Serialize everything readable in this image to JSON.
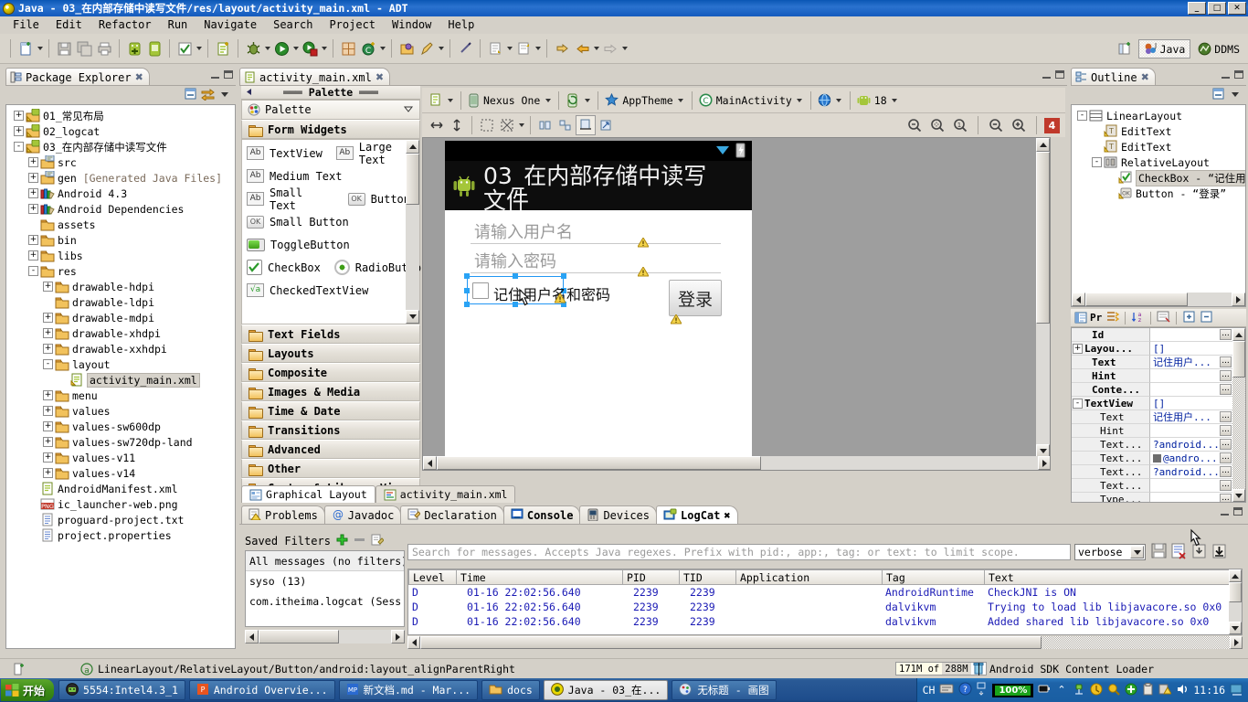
{
  "window": {
    "title": "Java - 03_在内部存储中读写文件/res/layout/activity_main.xml - ADT",
    "minimize": "_",
    "maximize": "□",
    "close": "✕"
  },
  "menu": {
    "items": [
      "File",
      "Edit",
      "Refactor",
      "Run",
      "Navigate",
      "Search",
      "Project",
      "Window",
      "Help"
    ]
  },
  "perspectives": {
    "java": "Java",
    "ddms": "DDMS"
  },
  "package_explorer": {
    "tab_label": "Package Explorer",
    "tree": [
      {
        "label": "01_常见布局",
        "depth": 0,
        "exp": "+",
        "icon": "android-project-icon"
      },
      {
        "label": "02_logcat",
        "depth": 0,
        "exp": "+",
        "icon": "android-project-icon"
      },
      {
        "label": "03_在内部存储中读写文件",
        "depth": 0,
        "exp": "-",
        "icon": "android-project-icon"
      },
      {
        "label": "src",
        "depth": 1,
        "exp": "+",
        "icon": "source-folder-icon"
      },
      {
        "label": "gen [Generated Java Files]",
        "depth": 1,
        "exp": "+",
        "icon": "source-folder-icon",
        "dim_from": 4
      },
      {
        "label": "Android 4.3",
        "depth": 1,
        "exp": "+",
        "icon": "library-icon"
      },
      {
        "label": "Android Dependencies",
        "depth": 1,
        "exp": "+",
        "icon": "library-icon"
      },
      {
        "label": "assets",
        "depth": 1,
        "exp": "",
        "icon": "folder-icon"
      },
      {
        "label": "bin",
        "depth": 1,
        "exp": "+",
        "icon": "folder-icon"
      },
      {
        "label": "libs",
        "depth": 1,
        "exp": "+",
        "icon": "folder-icon"
      },
      {
        "label": "res",
        "depth": 1,
        "exp": "-",
        "icon": "folder-icon"
      },
      {
        "label": "drawable-hdpi",
        "depth": 2,
        "exp": "+",
        "icon": "folder-icon"
      },
      {
        "label": "drawable-ldpi",
        "depth": 2,
        "exp": "",
        "icon": "folder-icon"
      },
      {
        "label": "drawable-mdpi",
        "depth": 2,
        "exp": "+",
        "icon": "folder-icon"
      },
      {
        "label": "drawable-xhdpi",
        "depth": 2,
        "exp": "+",
        "icon": "folder-icon"
      },
      {
        "label": "drawable-xxhdpi",
        "depth": 2,
        "exp": "+",
        "icon": "folder-icon"
      },
      {
        "label": "layout",
        "depth": 2,
        "exp": "-",
        "icon": "folder-icon"
      },
      {
        "label": "activity_main.xml",
        "depth": 3,
        "exp": "",
        "icon": "xml-layout-icon",
        "selected": true
      },
      {
        "label": "menu",
        "depth": 2,
        "exp": "+",
        "icon": "folder-icon"
      },
      {
        "label": "values",
        "depth": 2,
        "exp": "+",
        "icon": "folder-icon"
      },
      {
        "label": "values-sw600dp",
        "depth": 2,
        "exp": "+",
        "icon": "folder-icon"
      },
      {
        "label": "values-sw720dp-land",
        "depth": 2,
        "exp": "+",
        "icon": "folder-icon"
      },
      {
        "label": "values-v11",
        "depth": 2,
        "exp": "+",
        "icon": "folder-icon"
      },
      {
        "label": "values-v14",
        "depth": 2,
        "exp": "+",
        "icon": "folder-icon"
      },
      {
        "label": "AndroidManifest.xml",
        "depth": 1,
        "exp": "",
        "icon": "xml-file-icon"
      },
      {
        "label": "ic_launcher-web.png",
        "depth": 1,
        "exp": "",
        "icon": "png-file-icon"
      },
      {
        "label": "proguard-project.txt",
        "depth": 1,
        "exp": "",
        "icon": "text-file-icon"
      },
      {
        "label": "project.properties",
        "depth": 1,
        "exp": "",
        "icon": "text-file-icon"
      }
    ]
  },
  "editor": {
    "tab_label": "activity_main.xml",
    "palette": {
      "header": "Palette",
      "selector": "Palette",
      "group_open": "Form Widgets",
      "widgets": [
        [
          {
            "label": "TextView",
            "icon": "ab-icon"
          },
          {
            "label": "Large Text",
            "icon": "ab-icon"
          }
        ],
        [
          {
            "label": "Medium Text",
            "icon": "ab-icon"
          }
        ],
        [
          {
            "label": "Small Text",
            "icon": "ab-icon"
          },
          {
            "label": "Button",
            "icon": "ok-icon"
          }
        ],
        [
          {
            "label": "Small Button",
            "icon": "ok-icon"
          }
        ],
        [
          {
            "label": "ToggleButton",
            "icon": "toggle-icon"
          }
        ],
        [
          {
            "label": "CheckBox",
            "icon": "checkbox-icon"
          },
          {
            "label": "RadioButton",
            "icon": "radio-icon"
          }
        ],
        [
          {
            "label": "CheckedTextView",
            "icon": "checkedtext-icon"
          }
        ]
      ],
      "groups": [
        "Text Fields",
        "Layouts",
        "Composite",
        "Images & Media",
        "Time & Date",
        "Transitions",
        "Advanced",
        "Other",
        "Custom & Library Views"
      ]
    },
    "config": {
      "device": "Nexus One",
      "theme": "AppTheme",
      "activity": "MainActivity",
      "api": "18",
      "zoom_badge": "4"
    },
    "preview": {
      "app_title": "03_在内部存储中读写文件",
      "username_hint": "请输入用户名",
      "password_hint": "请输入密码",
      "checkbox_label": "记住用户名和密码",
      "login_button": "登录"
    },
    "bottom_tabs": [
      {
        "label": "Graphical Layout",
        "active": true
      },
      {
        "label": "activity_main.xml",
        "active": false
      }
    ]
  },
  "outline": {
    "tab_label": "Outline",
    "tree": [
      {
        "label": "LinearLayout",
        "depth": 0,
        "exp": "-",
        "icon": "linearlayout-icon"
      },
      {
        "label": "EditText",
        "depth": 1,
        "exp": "",
        "icon": "edittext-icon"
      },
      {
        "label": "EditText",
        "depth": 1,
        "exp": "",
        "icon": "edittext-icon"
      },
      {
        "label": "RelativeLayout",
        "depth": 1,
        "exp": "-",
        "icon": "relativelayout-icon"
      },
      {
        "label": "CheckBox - “记住用…",
        "depth": 2,
        "exp": "",
        "icon": "checkbox-icon",
        "selected": true
      },
      {
        "label": "Button - “登录”",
        "depth": 2,
        "exp": "",
        "icon": "button-icon"
      }
    ]
  },
  "properties": {
    "tab_label": "Pr",
    "rows": [
      {
        "name": "Id",
        "value": "",
        "indent": 1,
        "exp": "",
        "dots": true
      },
      {
        "name": "Layou...",
        "value": "[]",
        "indent": 0,
        "exp": "+",
        "dots": false
      },
      {
        "name": "Text",
        "value": "记住用户...",
        "indent": 1,
        "exp": "",
        "dots": true
      },
      {
        "name": "Hint",
        "value": "",
        "indent": 1,
        "exp": "",
        "dots": true
      },
      {
        "name": "Conte...",
        "value": "",
        "indent": 1,
        "exp": "",
        "dots": true
      },
      {
        "name": "TextView",
        "value": "[]",
        "indent": 0,
        "exp": "-",
        "dots": false
      },
      {
        "name": "Text",
        "value": "记住用户...",
        "indent": 2,
        "exp": "",
        "dots": true
      },
      {
        "name": "Hint",
        "value": "",
        "indent": 2,
        "exp": "",
        "dots": true
      },
      {
        "name": "Text...",
        "value": "?android...",
        "indent": 2,
        "exp": "",
        "dots": true
      },
      {
        "name": "Text...",
        "value": "@andro...",
        "indent": 2,
        "exp": "",
        "dots": true,
        "swatch": "#6e6e6e"
      },
      {
        "name": "Text...",
        "value": "?android...",
        "indent": 2,
        "exp": "",
        "dots": true
      },
      {
        "name": "Text...",
        "value": "",
        "indent": 2,
        "exp": "",
        "dots": true
      },
      {
        "name": "Type...",
        "value": "",
        "indent": 2,
        "exp": "",
        "dots": true
      }
    ]
  },
  "logcat": {
    "tabs": [
      {
        "label": "Problems",
        "icon": "problems-icon",
        "active": false
      },
      {
        "label": "Javadoc",
        "icon": "javadoc-icon",
        "active": false
      },
      {
        "label": "Declaration",
        "icon": "declaration-icon",
        "active": false
      },
      {
        "label": "Console",
        "icon": "console-icon",
        "active": false,
        "bold": true
      },
      {
        "label": "Devices",
        "icon": "devices-icon",
        "active": false
      },
      {
        "label": "LogCat",
        "icon": "logcat-icon",
        "active": true
      }
    ],
    "saved_filters_label": "Saved Filters",
    "filters": [
      {
        "label": "All messages (no filters)",
        "selected": true
      },
      {
        "label": "syso (13)",
        "selected": false
      },
      {
        "label": "com.itheima.logcat (Sess",
        "selected": false
      }
    ],
    "search_placeholder": "Search for messages. Accepts Java regexes. Prefix with pid:, app:, tag: or text: to limit scope.",
    "level_filter": "verbose",
    "columns": [
      "Level",
      "Time",
      "PID",
      "TID",
      "Application",
      "Tag",
      "Text"
    ],
    "rows": [
      {
        "level": "D",
        "time": "01-16 22:02:56.640",
        "pid": "2239",
        "tid": "2239",
        "app": "",
        "tag": "AndroidRuntime",
        "text": "CheckJNI is ON"
      },
      {
        "level": "D",
        "time": "01-16 22:02:56.640",
        "pid": "2239",
        "tid": "2239",
        "app": "",
        "tag": "dalvikvm",
        "text": "Trying to load lib libjavacore.so 0x0"
      },
      {
        "level": "D",
        "time": "01-16 22:02:56.640",
        "pid": "2239",
        "tid": "2239",
        "app": "",
        "tag": "dalvikvm",
        "text": "Added shared lib libjavacore.so 0x0"
      }
    ]
  },
  "statusbar": {
    "path": "LinearLayout/RelativeLayout/Button/android:layout_alignParentRight",
    "memory_used": "171M of",
    "memory_total": "288M",
    "job": "Android SDK Content Loader"
  },
  "taskbar": {
    "start": "开始",
    "items": [
      {
        "label": "5554:Intel4.3_1",
        "icon": "emulator-icon",
        "active": false
      },
      {
        "label": "Android Overvie...",
        "icon": "pdf-icon",
        "active": false
      },
      {
        "label": "新文档.md - Mar...",
        "icon": "markdown-icon",
        "active": false
      },
      {
        "label": "docs",
        "icon": "folder-icon",
        "active": false
      },
      {
        "label": "Java - 03_在...",
        "icon": "eclipse-icon",
        "active": true
      },
      {
        "label": "无标题 - 画图",
        "icon": "paint-icon",
        "active": false
      }
    ],
    "ime": "CH",
    "battery": "100%",
    "clock": "11:16"
  },
  "colors": {
    "accent_blue": "#2196f3",
    "chrome": "#d4d0c8",
    "canvas_gray": "#9e9e9e",
    "title_blue": "#145bbd",
    "log_text": "#1a1ab5"
  }
}
